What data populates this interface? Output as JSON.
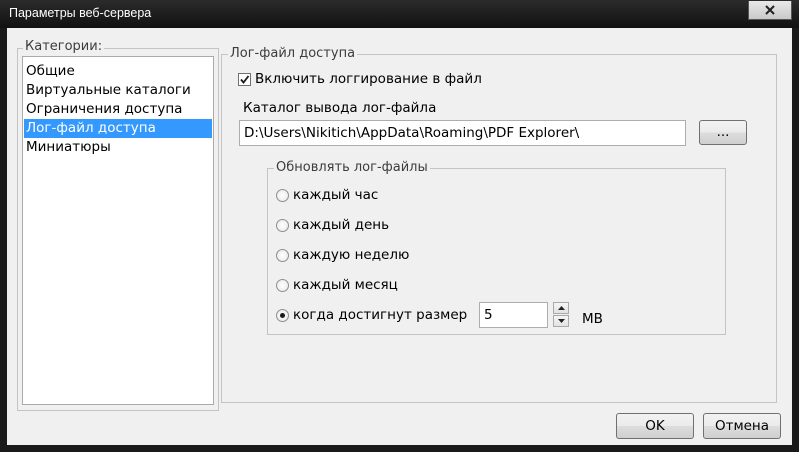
{
  "window": {
    "title": "Параметры веб-сервера"
  },
  "categories": {
    "legend": "Категории:",
    "items": [
      {
        "label": "Общие",
        "selected": false
      },
      {
        "label": "Виртуальные каталоги",
        "selected": false
      },
      {
        "label": "Ограничения доступа",
        "selected": false
      },
      {
        "label": "Лог-файл доступа",
        "selected": true
      },
      {
        "label": "Миниатюры",
        "selected": false
      }
    ]
  },
  "log": {
    "legend": "Лог-файл доступа",
    "enable_label": "Включить логгирование в файл",
    "enable_checked": true,
    "dir_label": "Каталог вывода лог-файла",
    "dir_value": "D:\\Users\\Nikitich\\AppData\\Roaming\\PDF Explorer\\",
    "browse_label": "...",
    "update": {
      "legend": "Обновлять лог-файлы",
      "options": [
        {
          "label": "каждый час",
          "checked": false
        },
        {
          "label": "каждый день",
          "checked": false
        },
        {
          "label": "каждую неделю",
          "checked": false
        },
        {
          "label": "каждый месяц",
          "checked": false
        },
        {
          "label": "когда достигнут размер",
          "checked": true
        }
      ],
      "size_value": "5",
      "size_unit": "MB"
    }
  },
  "buttons": {
    "ok": "OK",
    "cancel": "Отмена"
  },
  "icons": {
    "close": "close-icon",
    "check": "check-icon",
    "up": "arrow-up-icon",
    "down": "arrow-down-icon"
  }
}
